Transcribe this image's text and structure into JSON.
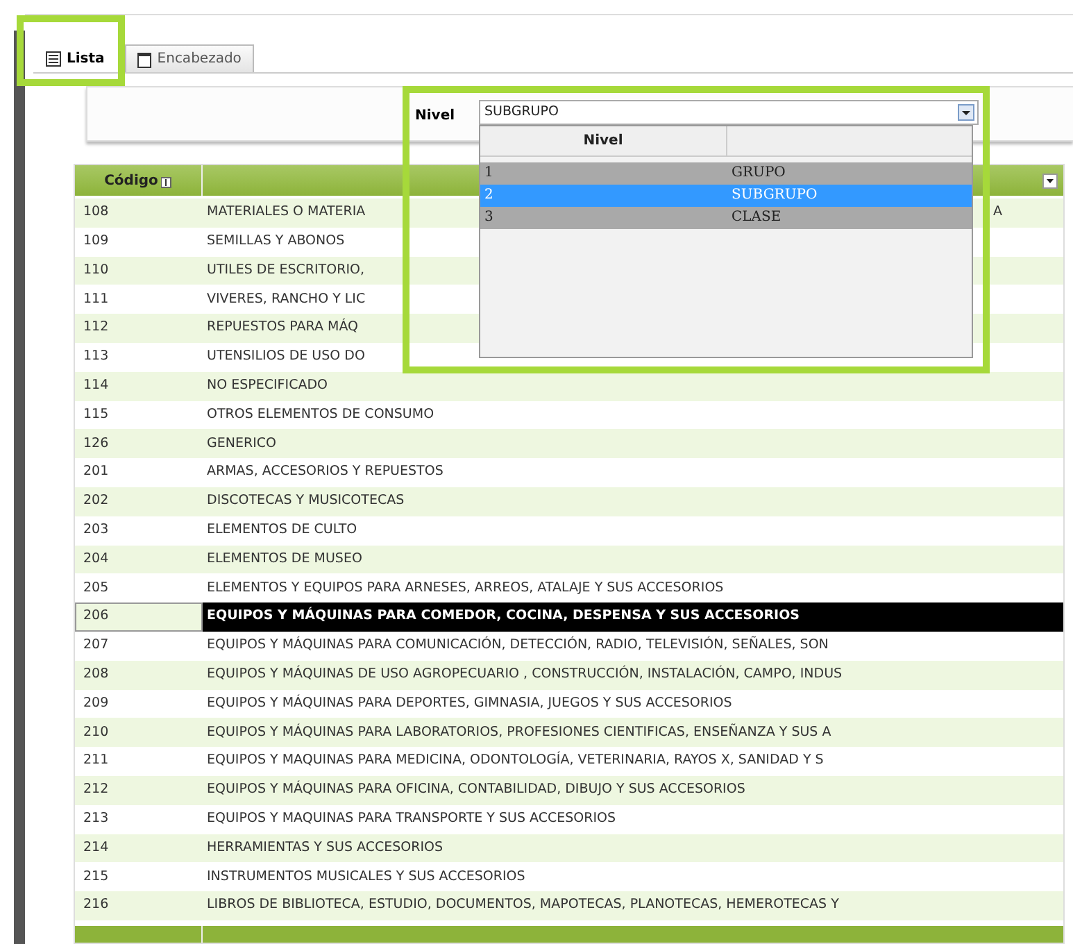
{
  "tabs": [
    {
      "label": "Lista",
      "selected": true,
      "highlighted": true
    },
    {
      "label": "Encabezado",
      "selected": false,
      "highlighted": false
    }
  ],
  "filter": {
    "label": "Nivel",
    "value": "SUBGRUPO",
    "highlighted": true,
    "dropdown": {
      "columns": [
        "Nivel"
      ],
      "options": [
        {
          "number": "1",
          "name": "GRUPO",
          "selected": false
        },
        {
          "number": "2",
          "name": "SUBGRUPO",
          "selected": true
        },
        {
          "number": "3",
          "name": "CLASE",
          "selected": false
        }
      ]
    }
  },
  "table": {
    "columns": [
      "Código"
    ],
    "rows": [
      {
        "code": "108",
        "description": "MATERIALES O MATERIA",
        "description_right": "A",
        "selected": false
      },
      {
        "code": "109",
        "description": "SEMILLAS Y ABONOS",
        "selected": false
      },
      {
        "code": "110",
        "description": "UTILES DE ESCRITORIO, ",
        "selected": false
      },
      {
        "code": "111",
        "description": "VIVERES, RANCHO Y LIC",
        "selected": false
      },
      {
        "code": "112",
        "description": "REPUESTOS PARA MÁQ",
        "selected": false
      },
      {
        "code": "113",
        "description": "UTENSILIOS DE USO DO",
        "selected": false
      },
      {
        "code": "114",
        "description": "NO ESPECIFICADO",
        "selected": false
      },
      {
        "code": "115",
        "description": "OTROS ELEMENTOS DE CONSUMO",
        "selected": false
      },
      {
        "code": "126",
        "description": "GENERICO",
        "selected": false
      },
      {
        "code": "201",
        "description": "ARMAS, ACCESORIOS Y REPUESTOS",
        "selected": false
      },
      {
        "code": "202",
        "description": "DISCOTECAS Y MUSICOTECAS",
        "selected": false
      },
      {
        "code": "203",
        "description": "ELEMENTOS DE CULTO",
        "selected": false
      },
      {
        "code": "204",
        "description": "ELEMENTOS DE MUSEO",
        "selected": false
      },
      {
        "code": "205",
        "description": "ELEMENTOS Y EQUIPOS PARA ARNESES, ARREOS, ATALAJE Y SUS ACCESORIOS",
        "selected": false
      },
      {
        "code": "206",
        "description": "EQUIPOS Y MÁQUINAS PARA COMEDOR, COCINA, DESPENSA Y SUS ACCESORIOS",
        "selected": true
      },
      {
        "code": "207",
        "description": "EQUIPOS Y MÁQUINAS PARA COMUNICACIÓN, DETECCIÓN, RADIO, TELEVISIÓN, SEÑALES, SON",
        "selected": false
      },
      {
        "code": "208",
        "description": "EQUIPOS Y MÁQUINAS DE USO AGROPECUARIO , CONSTRUCCIÓN, INSTALACIÓN, CAMPO, INDUS",
        "selected": false
      },
      {
        "code": "209",
        "description": "EQUIPOS Y MÁQUINAS PARA DEPORTES, GIMNASIA, JUEGOS Y SUS ACCESORIOS",
        "selected": false
      },
      {
        "code": "210",
        "description": "EQUIPOS Y MÁQUINAS PARA LABORATORIOS, PROFESIONES CIENTIFICAS, ENSEÑANZA Y SUS A",
        "selected": false
      },
      {
        "code": "211",
        "description": "EQUIPOS Y MAQUINAS PARA MEDICINA, ODONTOLOGÍA, VETERINARIA, RAYOS X, SANIDAD Y S",
        "selected": false
      },
      {
        "code": "212",
        "description": "EQUIPOS Y MÁQUINAS PARA OFICINA, CONTABILIDAD, DIBUJO Y SUS ACCESORIOS",
        "selected": false
      },
      {
        "code": "213",
        "description": "EQUIPOS Y MAQUINAS PARA TRANSPORTE Y SUS ACCESORIOS",
        "selected": false
      },
      {
        "code": "214",
        "description": "HERRAMIENTAS Y SUS ACCESORIOS",
        "selected": false
      },
      {
        "code": "215",
        "description": "INSTRUMENTOS MUSICALES Y SUS ACCESORIOS",
        "selected": false
      },
      {
        "code": "216",
        "description": "LIBROS DE BIBLIOTECA, ESTUDIO, DOCUMENTOS, MAPOTECAS, PLANOTECAS, HEMEROTECAS Y",
        "selected": false
      }
    ]
  }
}
